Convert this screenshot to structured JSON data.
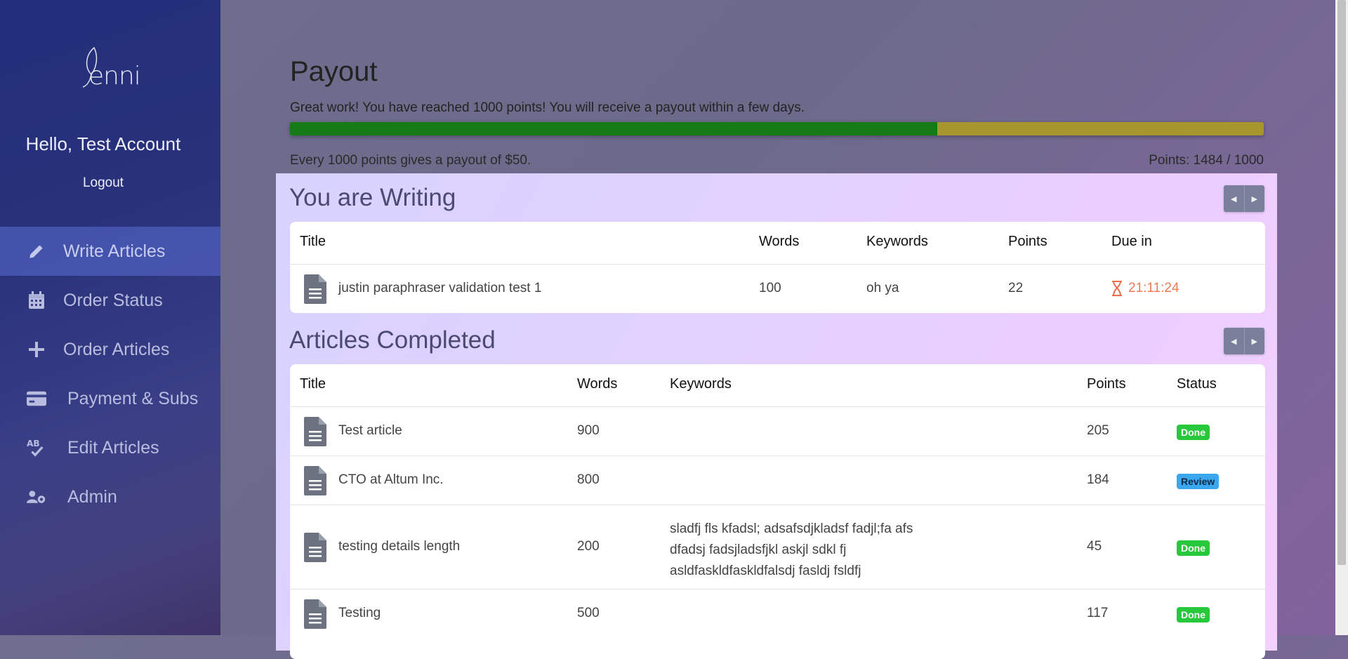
{
  "sidebar": {
    "logo_text": "enni",
    "greeting": "Hello, Test Account",
    "logout": "Logout",
    "items": [
      {
        "label": "Write Articles",
        "icon": "pencil-icon",
        "active": true
      },
      {
        "label": "Order Status",
        "icon": "calendar-icon"
      },
      {
        "label": "Order Articles",
        "icon": "plus-icon"
      },
      {
        "label": "Payment & Subs",
        "icon": "credit-card-icon"
      },
      {
        "label": "Edit Articles",
        "icon": "spellcheck-icon"
      },
      {
        "label": "Admin",
        "icon": "users-cog-icon"
      }
    ]
  },
  "payout": {
    "title": "Payout",
    "message": "Great work! You have reached 1000 points! You will receive a payout within a few days.",
    "progress_fraction": 0.665,
    "footer": "Every 1000 points gives a payout of $50.",
    "points": "Points: 1484 / 1000",
    "colors": {
      "progress_fill": "#167a17",
      "progress_track": "#a6962b"
    }
  },
  "writing": {
    "title": "You are Writing",
    "headers": {
      "title": "Title",
      "words": "Words",
      "keywords": "Keywords",
      "points": "Points",
      "due": "Due in"
    },
    "rows": [
      {
        "title": "justin paraphraser validation test 1",
        "words": "100",
        "keywords": "oh ya",
        "points": "22",
        "due": "21:11:24"
      }
    ]
  },
  "completed": {
    "title": "Articles Completed",
    "headers": {
      "title": "Title",
      "words": "Words",
      "keywords": "Keywords",
      "points": "Points",
      "status": "Status"
    },
    "rows": [
      {
        "title": "Test article",
        "words": "900",
        "keywords": "",
        "points": "205",
        "status": "Done"
      },
      {
        "title": "CTO at Altum Inc.",
        "words": "800",
        "keywords": "",
        "points": "184",
        "status": "Review"
      },
      {
        "title": "testing details length",
        "words": "200",
        "keywords_lines": [
          "sladfj fls kfadsl; adsafsdjkladsf fadjl;fa afs",
          "dfadsj fadsjladsfjkl askjl sdkl fj",
          "asldfaskldfaskldfalsdj fasldj fsldfj"
        ],
        "points": "45",
        "status": "Done"
      },
      {
        "title": "Testing",
        "words": "500",
        "keywords": "",
        "points": "117",
        "status": "Done"
      }
    ]
  },
  "status_colors": {
    "Done": "#28c83c",
    "Review": "#3aa7ef"
  }
}
